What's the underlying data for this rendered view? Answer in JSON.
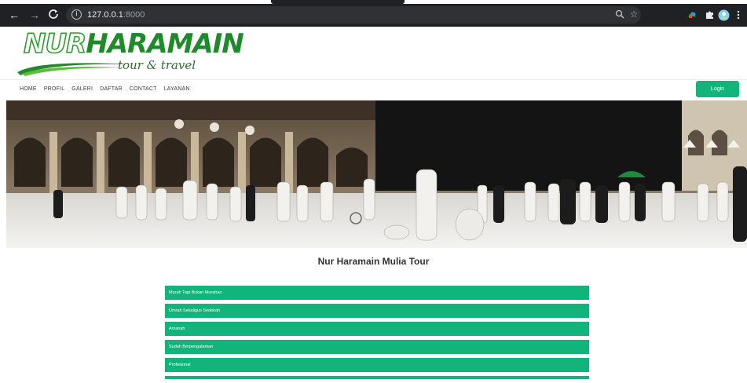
{
  "browser": {
    "url_host": "127.0.0.1",
    "url_port": ":8000",
    "icons": [
      "back-arrow-icon",
      "forward-arrow-icon",
      "reload-icon",
      "info-icon",
      "zoom-icon",
      "star-icon",
      "extension-icon",
      "puzzle-icon",
      "profile-icon",
      "menu-dots-icon"
    ]
  },
  "logo": {
    "part1": "NUR",
    "part2": "HARAMAIN",
    "subtitle": "tour & travel"
  },
  "nav": {
    "items": [
      "HOME",
      "PROFIL",
      "GALERI",
      "DAFTAR",
      "CONTACT",
      "LAYANAN"
    ],
    "login_label": "Login"
  },
  "main": {
    "title": "Nur Haramain Mulia Tour",
    "features": [
      "Murah Tapi Bukan Murahan",
      "Umrah Sekaligus Sedekah",
      "Amanah",
      "Sudah Berpengalaman",
      "Profesional"
    ]
  },
  "colors": {
    "accent": "#13b47b",
    "logo_green": "#1e8a2a",
    "chrome_dark": "#202124"
  }
}
